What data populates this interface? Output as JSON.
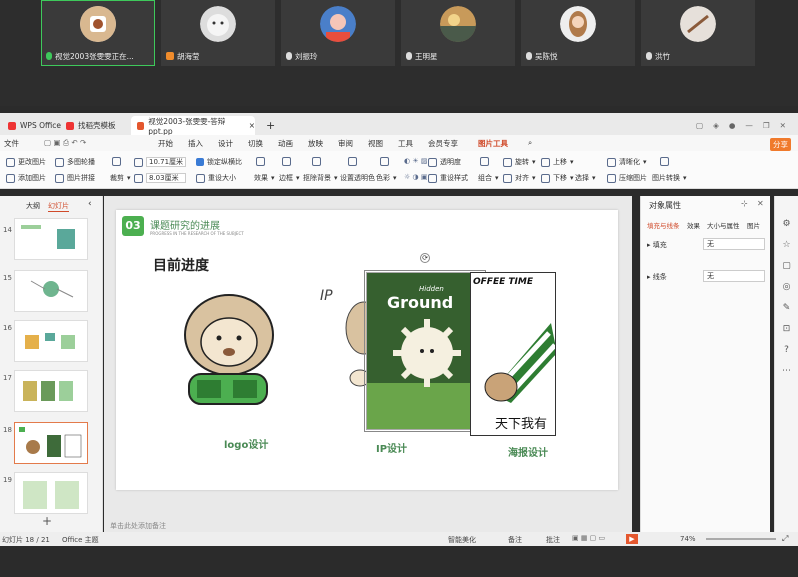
{
  "participants": [
    {
      "name": "视觉2003张雯雯正在..."
    },
    {
      "name": "胡海莹"
    },
    {
      "name": "刘振玲"
    },
    {
      "name": "王明星"
    },
    {
      "name": "吴陈悦"
    },
    {
      "name": "洪竹"
    }
  ],
  "app": {
    "name": "WPS Office",
    "tab2": "找稻壳模板",
    "doc_tab": "视觉2003-张雯雯-答辩ppt.pp"
  },
  "menu": {
    "file": "文件",
    "items": [
      "开始",
      "插入",
      "设计",
      "切换",
      "动画",
      "放映",
      "审阅",
      "视图",
      "工具",
      "会员专享",
      "图片工具"
    ],
    "share": "分享"
  },
  "ribbon": {
    "change_pic": "更改图片",
    "add_pic": "添加图片",
    "multi_pic": "多图轮播",
    "pic_stitch": "图片拼接",
    "width": "10.71厘米",
    "height": "8.03厘米",
    "lock_ratio": "锁定纵横比",
    "reset_size": "重设大小",
    "crop": "裁剪",
    "effects": "效果",
    "border": "边框",
    "remove_bg": "抠除背景",
    "set_transparent": "设置透明色",
    "color": "色彩",
    "transparency": "透明度",
    "reset_style": "重设样式",
    "rotate": "旋转",
    "align": "对齐",
    "up": "上移",
    "down": "下移",
    "select": "选择",
    "group": "组合",
    "sharpen": "清晰化",
    "compress": "压缩图片",
    "pic_convert": "图片转换"
  },
  "leftpane": {
    "outline": "大纲",
    "slides": "幻灯片",
    "numbers": [
      "14",
      "15",
      "16",
      "17",
      "18",
      "19"
    ]
  },
  "slide": {
    "section_no": "03",
    "section_title": "课题研究的进展",
    "section_sub": "PROGRESS IN THE RESEARCH OF THE SUBJECT",
    "heading": "目前进度",
    "label_logo": "logo设计",
    "label_ip": "IP设计",
    "label_poster": "海报设计",
    "poster1_title": "Ground",
    "poster1_small": "Hidden",
    "poster2_title": "OFFEE TIME",
    "poster2_caption": "天下我有",
    "ip_letters": "IP"
  },
  "notes_placeholder": "单击此处添加备注",
  "rightpanel": {
    "title": "对象属性",
    "tabs": [
      "填充与线条",
      "效果",
      "大小与属性",
      "图片"
    ],
    "fill": "填充",
    "line": "线条",
    "none": "无"
  },
  "status": {
    "slide_count": "幻灯片 18 / 21",
    "theme": "Office 主题",
    "smart": "智能美化",
    "notes": "备注",
    "comment": "批注",
    "zoom": "74%"
  }
}
